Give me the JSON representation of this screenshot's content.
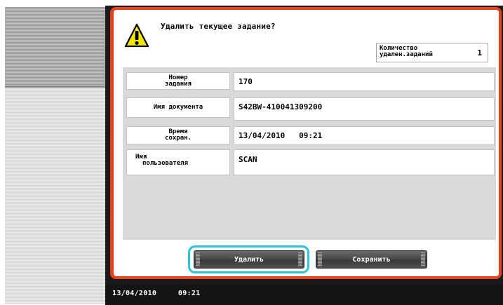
{
  "dialog": {
    "title": "Удалить текущее задание?",
    "count": {
      "label_line1": "Количество",
      "label_line2": "удален.заданий",
      "value": "1"
    }
  },
  "rows": [
    {
      "label_line1": "Номер",
      "label_line2": "задания",
      "value": "170"
    },
    {
      "label_line1": "Имя документа",
      "label_line2": "",
      "value": "S42BW-410041309200"
    },
    {
      "label_line1": "Время",
      "label_line2": "сохран.",
      "value": "13/04/2010   09:21"
    },
    {
      "label_line1": "Имя",
      "label_line2": "пользователя",
      "value": "SCAN"
    }
  ],
  "buttons": {
    "delete": "Удалить",
    "save": "Сохранить"
  },
  "status": {
    "date": "13/04/2010",
    "time": "09:21"
  },
  "colors": {
    "frame_border": "#e8401c",
    "focus_ring": "#2ac4e2",
    "warning_fill": "#f5e600"
  },
  "icons": {
    "warning": "warning-triangle-icon"
  }
}
